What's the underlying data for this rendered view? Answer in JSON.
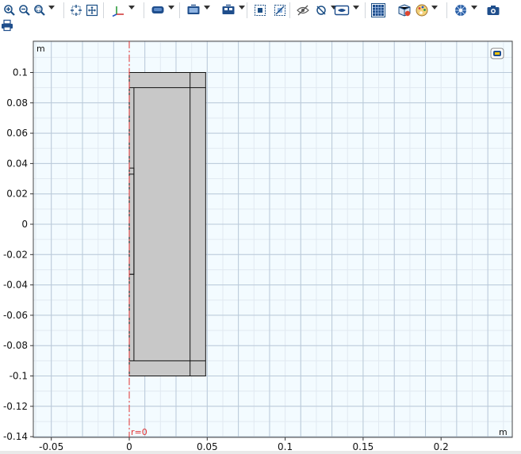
{
  "toolbar": {
    "buttons": [
      {
        "name": "zoom-in-button",
        "icon": "zoom-in-icon",
        "caret": false
      },
      {
        "name": "zoom-out-button",
        "icon": "zoom-out-icon",
        "caret": false
      },
      {
        "name": "zoom-box-button",
        "icon": "zoom-box-icon",
        "caret": true
      },
      {
        "name": "zoom-to-selection-button",
        "icon": "zoom-selection-icon",
        "caret": false
      },
      {
        "name": "zoom-extents-button",
        "icon": "zoom-extents-icon",
        "caret": false
      },
      {
        "name": "axes-orientation-button",
        "icon": "axes-icon",
        "caret": true
      },
      {
        "name": "scene-light-button",
        "icon": "scene-light-icon",
        "caret": true
      },
      {
        "name": "views-button",
        "icon": "views-icon",
        "caret": true
      },
      {
        "name": "render-mode-button",
        "icon": "render-mode-icon",
        "caret": true
      },
      {
        "name": "select-box-button",
        "icon": "select-box-icon",
        "caret": false
      },
      {
        "name": "deselect-box-button",
        "icon": "deselect-box-icon",
        "caret": false
      },
      {
        "name": "hide-button",
        "icon": "hide-eye-icon",
        "caret": false
      },
      {
        "name": "reset-hiding-button",
        "icon": "reset-hiding-icon",
        "caret": true
      },
      {
        "name": "view-options-button",
        "icon": "view-eye-icon",
        "caret": true
      },
      {
        "name": "grid-toggle-button",
        "icon": "grid-icon",
        "caret": false
      },
      {
        "name": "transparency-button",
        "icon": "transparency-icon",
        "caret": false
      },
      {
        "name": "color-options-button",
        "icon": "palette-icon",
        "caret": true
      },
      {
        "name": "camera-settings-button",
        "icon": "aperture-icon",
        "caret": true
      },
      {
        "name": "image-snapshot-button",
        "icon": "camera-icon",
        "caret": false
      },
      {
        "name": "print-button",
        "icon": "printer-icon",
        "caret": false
      }
    ]
  },
  "plot": {
    "y_unit": "m",
    "x_unit": "m",
    "axis_marker_label": "r=0",
    "axis_marker_color": "#e03030",
    "grid_major_color": "#b9c9d9",
    "grid_minor_color": "#e1e9f1",
    "background_color": "#f3fbff",
    "geometry_fill": "#c8c8c8",
    "x_ticks": [
      {
        "value": -0.05,
        "label": "-0.05"
      },
      {
        "value": 0,
        "label": "0"
      },
      {
        "value": 0.05,
        "label": "0.05"
      },
      {
        "value": 0.1,
        "label": "0.1"
      },
      {
        "value": 0.15,
        "label": "0.15"
      },
      {
        "value": 0.2,
        "label": "0.2"
      }
    ],
    "y_ticks": [
      {
        "value": 0.1,
        "label": "0.1"
      },
      {
        "value": 0.08,
        "label": "0.08"
      },
      {
        "value": 0.06,
        "label": "0.06"
      },
      {
        "value": 0.04,
        "label": "0.04"
      },
      {
        "value": 0.02,
        "label": "0.02"
      },
      {
        "value": 0,
        "label": "0"
      },
      {
        "value": -0.02,
        "label": "-0.02"
      },
      {
        "value": -0.04,
        "label": "-0.04"
      },
      {
        "value": -0.06,
        "label": "-0.06"
      },
      {
        "value": -0.08,
        "label": "-0.08"
      },
      {
        "value": -0.1,
        "label": "-0.1"
      },
      {
        "value": -0.12,
        "label": "-0.12"
      },
      {
        "value": -0.14,
        "label": "-0.14"
      }
    ],
    "x_range": [
      -0.065,
      0.242
    ],
    "y_range": [
      -0.14,
      0.117
    ],
    "geometry": {
      "outer": {
        "r": [
          0,
          0.049
        ],
        "z": [
          -0.1,
          0.1
        ]
      },
      "inner_wall_r": 0.003,
      "outer_wall_r": 0.039,
      "top_cap_z": 0.09,
      "bottom_cap_z": -0.09,
      "insert": {
        "r": [
          0,
          0.003
        ],
        "z": [
          -0.033,
          0.037
        ]
      },
      "insert_steps": [
        0.033,
        -0.033
      ]
    }
  }
}
